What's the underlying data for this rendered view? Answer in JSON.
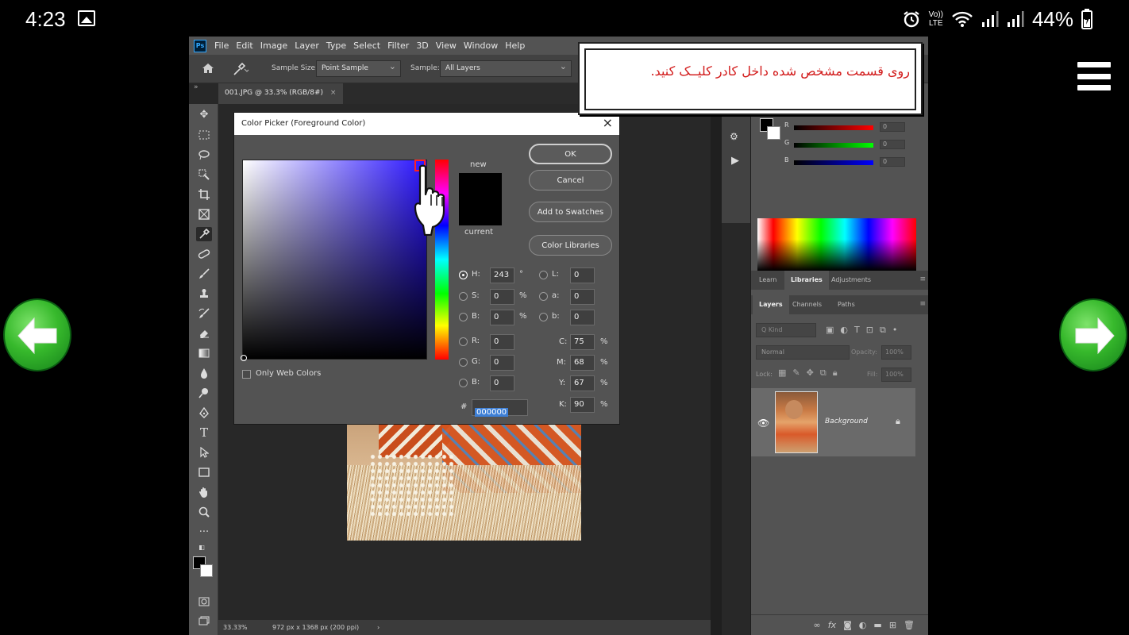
{
  "status_bar": {
    "time": "4:23",
    "lte_top": "Vo))",
    "lte_bottom": "LTE",
    "battery": "44%"
  },
  "nav": {
    "menu_icon": "hamburger-icon",
    "prev_icon": "arrow-left-icon",
    "next_icon": "arrow-right-icon",
    "accent_color": "#37b92c"
  },
  "photoshop": {
    "logo": "Ps",
    "menu": [
      "File",
      "Edit",
      "Image",
      "Layer",
      "Type",
      "Select",
      "Filter",
      "3D",
      "View",
      "Window",
      "Help"
    ],
    "options": {
      "sample_size_label": "Sample Size:",
      "sample_size_value": "Point Sample",
      "sample_label": "Sample:",
      "sample_value": "All Layers"
    },
    "doc_tab": "001.JPG @ 33.3% (RGB/8#)",
    "doc_tab_close": "×",
    "status": {
      "zoom": "33.33%",
      "doc_info": "972 px x 1368 px (200 ppi)",
      "arrow": "›"
    },
    "color_panel": {
      "rows": [
        {
          "label": "R",
          "value": "0"
        },
        {
          "label": "G",
          "value": "0"
        },
        {
          "label": "B",
          "value": "0"
        }
      ]
    },
    "panel_tabs_top": [
      "Learn",
      "Libraries",
      "Adjustments"
    ],
    "panel_tabs_layers": [
      "Layers",
      "Channels",
      "Paths"
    ],
    "layers": {
      "filter_placeholder": "Q Kind",
      "blend_mode": "Normal",
      "opacity_label": "Opacity:",
      "opacity_value": "100%",
      "lock_label": "Lock:",
      "fill_label": "Fill:",
      "fill_value": "100%",
      "layer_name": "Background"
    }
  },
  "color_picker": {
    "title": "Color Picker (Foreground Color)",
    "close": "×",
    "label_new": "new",
    "label_current": "current",
    "buttons": {
      "ok": "OK",
      "cancel": "Cancel",
      "add_swatches": "Add to Swatches",
      "color_libraries": "Color Libraries"
    },
    "hsb": [
      {
        "label": "H:",
        "value": "243",
        "unit": "°"
      },
      {
        "label": "S:",
        "value": "0",
        "unit": "%"
      },
      {
        "label": "B:",
        "value": "0",
        "unit": "%"
      }
    ],
    "rgb": [
      {
        "label": "R:",
        "value": "0"
      },
      {
        "label": "G:",
        "value": "0"
      },
      {
        "label": "B:",
        "value": "0"
      }
    ],
    "lab": [
      {
        "label": "L:",
        "value": "0"
      },
      {
        "label": "a:",
        "value": "0"
      },
      {
        "label": "b:",
        "value": "0"
      }
    ],
    "cmyk": [
      {
        "label": "C:",
        "value": "75",
        "unit": "%"
      },
      {
        "label": "M:",
        "value": "68",
        "unit": "%"
      },
      {
        "label": "Y:",
        "value": "67",
        "unit": "%"
      },
      {
        "label": "K:",
        "value": "90",
        "unit": "%"
      }
    ],
    "hex_label": "#",
    "hex_value": "000000",
    "only_web_colors": "Only Web Colors",
    "field_base_color": "#2a14ff"
  },
  "callout": {
    "text": "روی قسمت مشخص شده داخل کادر کلیــک کنید.",
    "text_color": "#d21a1a"
  }
}
